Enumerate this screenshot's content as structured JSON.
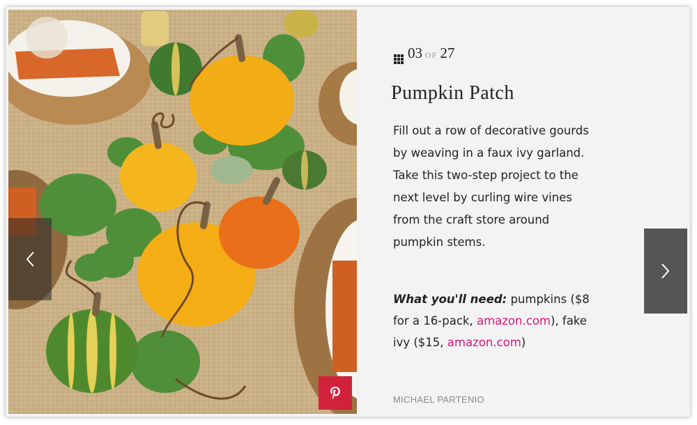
{
  "slideshow": {
    "counter": {
      "current": "03",
      "of": "OF",
      "total": "27"
    },
    "title": "Pumpkin Patch",
    "description": "Fill out a row of decorative gourds by weaving in a faux ivy garland. Take this two-step project to the next level by curling wire vines from the craft store around pumpkin stems.",
    "needs": {
      "label": "What you'll need:",
      "text1": " pumpkins ($8 for a 16-pack, ",
      "link1": "amazon.com",
      "text2": "), fake ivy ($15, ",
      "link2": "amazon.com",
      "text3": ")"
    },
    "credit": "MICHAEL PARTENIO",
    "colors": {
      "link": "#d6177a",
      "pinterest": "#d0233b",
      "nav": "#555555"
    },
    "icons": {
      "prev": "chevron-left-icon",
      "next": "chevron-right-icon",
      "pin": "pinterest-icon",
      "grid": "grid-icon"
    }
  }
}
